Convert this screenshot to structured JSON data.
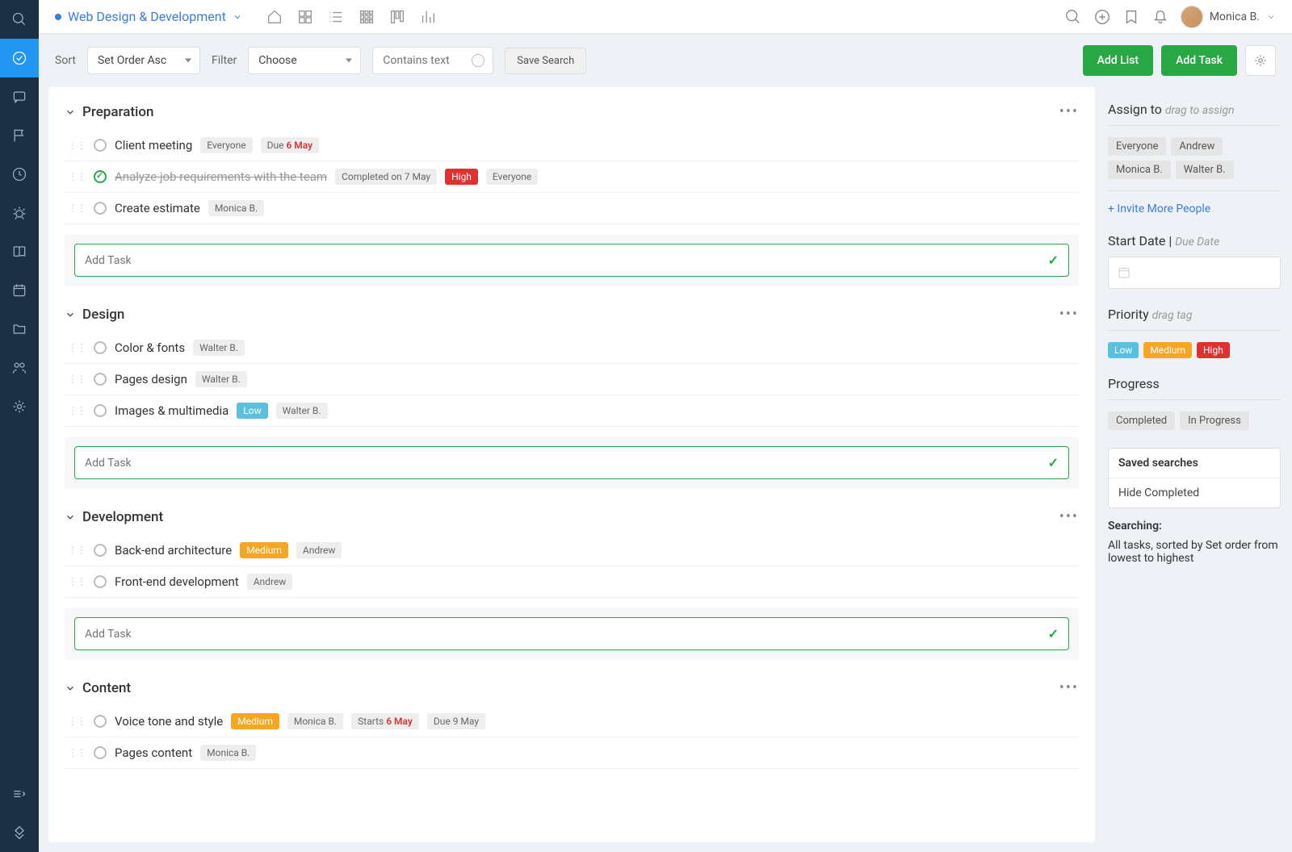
{
  "project_title": "Web Design & Development",
  "user_name": "Monica B.",
  "toolbar": {
    "sort_label": "Sort",
    "sort_value": "Set Order Asc",
    "filter_label": "Filter",
    "filter_value": "Choose",
    "search_placeholder": "Contains text",
    "save_search": "Save Search",
    "add_list": "Add List",
    "add_task": "Add Task"
  },
  "add_task_placeholder": "Add Task",
  "lists": [
    {
      "title": "Preparation",
      "tasks": [
        {
          "title": "Client meeting",
          "done": false,
          "tags": [
            {
              "text": "Everyone",
              "cls": "tag"
            },
            {
              "text": "Due ",
              "extra": "6 May",
              "cls": "tag due"
            }
          ]
        },
        {
          "title": "Analyze job requirements with the team",
          "done": true,
          "tags": [
            {
              "text": "Completed on 7 May",
              "cls": "tag"
            },
            {
              "text": "High",
              "cls": "tag high"
            },
            {
              "text": "Everyone",
              "cls": "tag"
            }
          ]
        },
        {
          "title": "Create estimate",
          "done": false,
          "tags": [
            {
              "text": "Monica B.",
              "cls": "tag"
            }
          ]
        }
      ]
    },
    {
      "title": "Design",
      "tasks": [
        {
          "title": "Color & fonts",
          "done": false,
          "tags": [
            {
              "text": "Walter B.",
              "cls": "tag"
            }
          ]
        },
        {
          "title": "Pages design",
          "done": false,
          "tags": [
            {
              "text": "Walter B.",
              "cls": "tag"
            }
          ]
        },
        {
          "title": "Images & multimedia",
          "done": false,
          "tags": [
            {
              "text": "Low",
              "cls": "tag low"
            },
            {
              "text": "Walter B.",
              "cls": "tag"
            }
          ]
        }
      ]
    },
    {
      "title": "Development",
      "tasks": [
        {
          "title": "Back-end architecture",
          "done": false,
          "tags": [
            {
              "text": "Medium",
              "cls": "tag medium"
            },
            {
              "text": "Andrew",
              "cls": "tag"
            }
          ]
        },
        {
          "title": "Front-end development",
          "done": false,
          "tags": [
            {
              "text": "Andrew",
              "cls": "tag"
            }
          ]
        }
      ]
    },
    {
      "title": "Content",
      "no_add": true,
      "tasks": [
        {
          "title": "Voice tone and style",
          "done": false,
          "tags": [
            {
              "text": "Medium",
              "cls": "tag medium"
            },
            {
              "text": "Monica B.",
              "cls": "tag"
            },
            {
              "text": "Starts ",
              "extra": "6 May",
              "cls": "tag due"
            },
            {
              "text": "Due 9 May",
              "cls": "tag"
            }
          ]
        },
        {
          "title": "Pages content",
          "done": false,
          "tags": [
            {
              "text": "Monica B.",
              "cls": "tag"
            }
          ]
        }
      ]
    }
  ],
  "sidebar": {
    "assign_title": "Assign to",
    "assign_hint": "drag to assign",
    "assignees": [
      "Everyone",
      "Andrew",
      "Monica B.",
      "Walter B."
    ],
    "invite_link": "+ Invite More People",
    "date_title": "Start Date |",
    "date_hint": "Due Date",
    "priority_title": "Priority",
    "priority_hint": "drag tag",
    "priorities": [
      {
        "text": "Low",
        "cls": "tag low"
      },
      {
        "text": "Medium",
        "cls": "tag medium"
      },
      {
        "text": "High",
        "cls": "tag high"
      }
    ],
    "progress_title": "Progress",
    "progress_tags": [
      "Completed",
      "In Progress"
    ],
    "saved_title": "Saved searches",
    "saved_items": [
      "Hide Completed"
    ],
    "searching_title": "Searching:",
    "searching_text": "All tasks, sorted by Set order from lowest to highest"
  }
}
